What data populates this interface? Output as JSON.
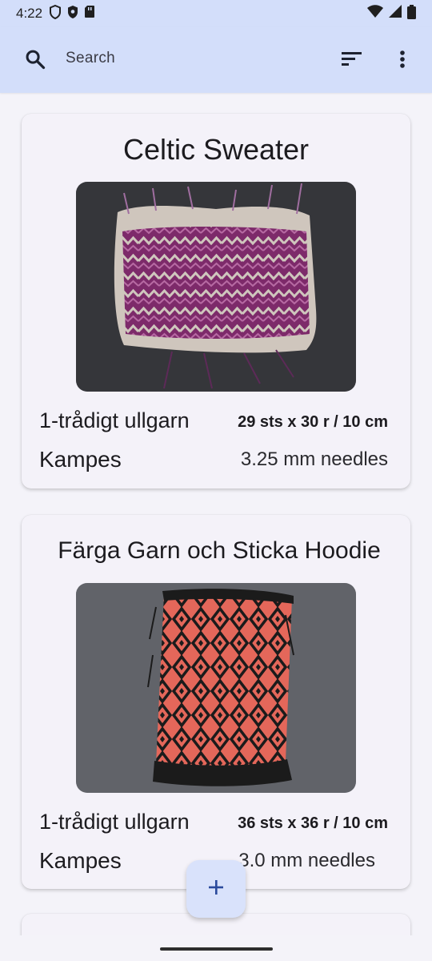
{
  "status_bar": {
    "time": "4:22"
  },
  "app_bar": {
    "search_placeholder": "Search"
  },
  "projects": [
    {
      "title": "Celtic Sweater",
      "yarn": "1-trådigt ullgarn",
      "brand": "Kampes",
      "gauge": "29 sts x 30 r / 10 cm",
      "needles": "3.25 mm needles",
      "colors": {
        "main": "#7d2a6a",
        "contrast": "#cfc6bd",
        "background": "#3a3a3c"
      }
    },
    {
      "title": "Färga Garn och Sticka Hoodie",
      "yarn": "1-trådigt ullgarn",
      "brand": "Kampes",
      "gauge": "36 sts x 36 r / 10 cm",
      "needles": "3.0 mm needles",
      "colors": {
        "main": "#e4675a",
        "contrast": "#1b1b1b",
        "background": "#5b5d63"
      }
    }
  ],
  "colors": {
    "app_bar": "#d3defa",
    "surface": "#f4f3f9",
    "fab": "#d9e2fb",
    "accent": "#2a4a9c"
  }
}
